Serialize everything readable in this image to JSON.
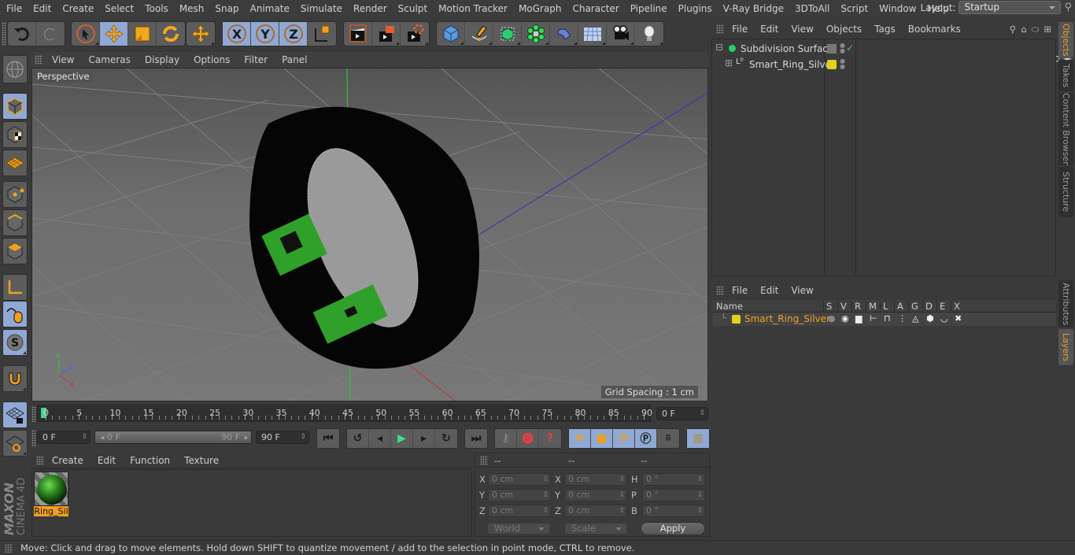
{
  "menubar": {
    "items": [
      "File",
      "Edit",
      "Create",
      "Select",
      "Tools",
      "Mesh",
      "Snap",
      "Animate",
      "Simulate",
      "Render",
      "Sculpt",
      "Motion Tracker",
      "MoGraph",
      "Character",
      "Pipeline",
      "Plugins",
      "V-Ray Bridge",
      "3DToAll",
      "Script",
      "Window",
      "Help"
    ],
    "layout_label": "Layout:",
    "layout_value": "Startup"
  },
  "toolbar": {
    "icons": [
      "undo-icon",
      "redo-icon",
      "live-selection-icon",
      "move-icon",
      "scale-icon",
      "rotate-icon",
      "recent-tools-icon",
      "x-axis-lock-icon",
      "y-axis-lock-icon",
      "z-axis-lock-icon",
      "coordinate-system-icon",
      "render-view-icon",
      "render-to-picture-viewer-icon",
      "render-settings-icon",
      "cube-object-icon",
      "pen-spline-icon",
      "subdivision-surface-icon",
      "mograph-cloner-icon",
      "deformer-bend-icon",
      "floor-environment-icon",
      "camera-icon",
      "light-icon"
    ],
    "axes": [
      "X",
      "Y",
      "Z"
    ]
  },
  "viewport": {
    "menu": [
      "View",
      "Cameras",
      "Display",
      "Options",
      "Filter",
      "Panel"
    ],
    "camera_label": "Perspective",
    "grid_spacing": "Grid Spacing : 1 cm"
  },
  "timeline": {
    "ticks": [
      "0",
      "5",
      "10",
      "15",
      "20",
      "25",
      "30",
      "35",
      "40",
      "45",
      "50",
      "55",
      "60",
      "65",
      "70",
      "75",
      "80",
      "85",
      "90"
    ],
    "current_frame": "0 F",
    "start_field": "0 F",
    "range_start": "0 F",
    "range_end": "90 F",
    "end_field": "90 F"
  },
  "material_manager": {
    "menu": [
      "Create",
      "Edit",
      "Function",
      "Texture"
    ],
    "materials": [
      {
        "name": "Ring_Sil"
      }
    ]
  },
  "coordinates": {
    "headers": [
      "--",
      "--",
      "--"
    ],
    "position": {
      "x": "0 cm",
      "y": "0 cm",
      "z": "0 cm"
    },
    "size": {
      "x": "0 cm",
      "y": "0 cm",
      "z": "0 cm"
    },
    "rotation": {
      "h": "0 °",
      "p": "0 °",
      "b": "0 °"
    },
    "labels": {
      "x": "X",
      "y": "Y",
      "z": "Z",
      "h": "H",
      "p": "P",
      "b": "B"
    },
    "mode_dropdown": "World",
    "size_dropdown": "Scale",
    "apply_label": "Apply"
  },
  "status_bar": {
    "text": "Move: Click and drag to move elements. Hold down SHIFT to quantize movement / add to the selection in point mode, CTRL to remove."
  },
  "object_manager": {
    "menu": [
      "File",
      "Edit",
      "View",
      "Objects",
      "Tags",
      "Bookmarks"
    ],
    "objects": [
      {
        "name": "Subdivision Surface",
        "enabled": true
      },
      {
        "name": "Smart_Ring_Silver",
        "layer_color": "#e0d020"
      }
    ]
  },
  "layer_manager": {
    "menu": [
      "File",
      "Edit",
      "View"
    ],
    "columns": [
      "Name",
      "S",
      "V",
      "R",
      "M",
      "L",
      "A",
      "G",
      "D",
      "E",
      "X"
    ],
    "layers": [
      {
        "name": "Smart_Ring_Silver",
        "color": "#e0d020"
      }
    ]
  },
  "right_tabs": {
    "top": [
      {
        "label": "Objects",
        "active": true
      },
      {
        "label": "Takes",
        "active": false
      },
      {
        "label": "Content Browser",
        "active": false
      },
      {
        "label": "Structure",
        "active": false
      }
    ],
    "bottom": [
      {
        "label": "Attributes",
        "active": false
      },
      {
        "label": "Layers",
        "active": true
      }
    ]
  },
  "branding": {
    "company": "MAXON",
    "product": "CINEMA 4D"
  },
  "colors": {
    "accent_blue": "#8fa9d4",
    "accent_orange": "#f0a020",
    "play_green": "#3ddc84",
    "layer_yellow": "#e0d020"
  }
}
